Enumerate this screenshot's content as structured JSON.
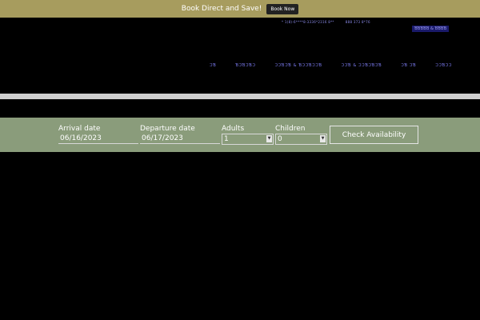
{
  "promo": {
    "text": "Book Direct and Save!",
    "button": "Book Now"
  },
  "header": {
    "contact": [
      "* 1(8)-6****8-3336*2316 8**",
      "888 373 8*76"
    ],
    "book_link": "ƁƁƁƁƁ & ƁƁƁƁ",
    "nav": [
      "ƆƁ",
      "ƁƆƁƆƁƆ",
      "ƆƆƁƆƁ  &  ƁƆƆƁƆƆƁ",
      "ƆƆƁ & ƆƆƁƆƁƆƁ",
      "ƆƁ  ƆƁ",
      "ƆƆƁƆƆ"
    ]
  },
  "booking": {
    "arrival_label": "Arrival date",
    "arrival_value": "06/16/2023",
    "departure_label": "Departure date",
    "departure_value": "06/17/2023",
    "adults_label": "Adults",
    "adults_value": "1",
    "children_label": "Children",
    "children_value": "0",
    "check_button": "Check Availability"
  },
  "colors": {
    "promo_bar": "#a79c5e",
    "booking_bar": "#8a9c7b",
    "divider": "#cfcfcf"
  }
}
